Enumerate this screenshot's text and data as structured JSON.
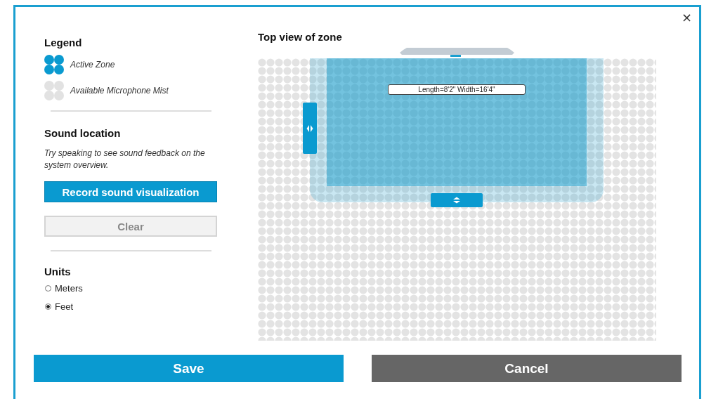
{
  "close": "×",
  "legend": {
    "title": "Legend",
    "items": [
      {
        "kind": "active",
        "label": "Active Zone"
      },
      {
        "kind": "available",
        "label": "Available Microphone Mist"
      }
    ]
  },
  "sound_location": {
    "title": "Sound location",
    "hint": "Try speaking to see sound feedback on the system overview.",
    "buttons": [
      {
        "label": "Record sound visualization",
        "disabled": false
      },
      {
        "label": "Clear",
        "disabled": true
      }
    ]
  },
  "units": {
    "title": "Units",
    "options": [
      {
        "label": "Meters",
        "selected": false
      },
      {
        "label": "Feet",
        "selected": true
      }
    ]
  },
  "zone": {
    "title": "Top view of zone",
    "dimensions": "Length=8'2\" Width=16'4\""
  },
  "footer": {
    "buttons": [
      {
        "kind": "primary",
        "label": "Save"
      },
      {
        "kind": "secondary",
        "label": "Cancel"
      }
    ]
  }
}
